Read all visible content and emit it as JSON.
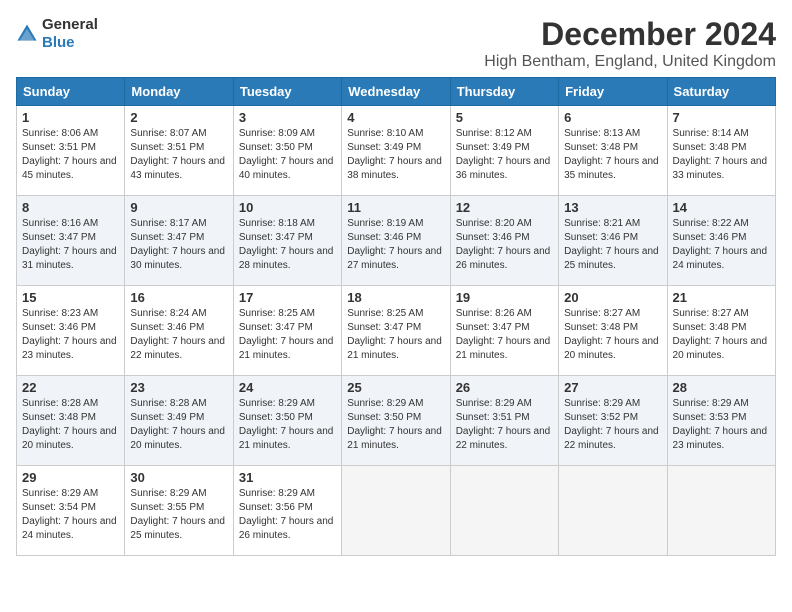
{
  "header": {
    "logo_general": "General",
    "logo_blue": "Blue",
    "title": "December 2024",
    "subtitle": "High Bentham, England, United Kingdom"
  },
  "calendar": {
    "days_of_week": [
      "Sunday",
      "Monday",
      "Tuesday",
      "Wednesday",
      "Thursday",
      "Friday",
      "Saturday"
    ],
    "weeks": [
      [
        null,
        null,
        null,
        null,
        null,
        null,
        null
      ]
    ]
  },
  "cells": {
    "w1": [
      {
        "day": "1",
        "sunrise": "8:06 AM",
        "sunset": "3:51 PM",
        "daylight": "7 hours and 45 minutes."
      },
      {
        "day": "2",
        "sunrise": "8:07 AM",
        "sunset": "3:51 PM",
        "daylight": "7 hours and 43 minutes."
      },
      {
        "day": "3",
        "sunrise": "8:09 AM",
        "sunset": "3:50 PM",
        "daylight": "7 hours and 40 minutes."
      },
      {
        "day": "4",
        "sunrise": "8:10 AM",
        "sunset": "3:49 PM",
        "daylight": "7 hours and 38 minutes."
      },
      {
        "day": "5",
        "sunrise": "8:12 AM",
        "sunset": "3:49 PM",
        "daylight": "7 hours and 36 minutes."
      },
      {
        "day": "6",
        "sunrise": "8:13 AM",
        "sunset": "3:48 PM",
        "daylight": "7 hours and 35 minutes."
      },
      {
        "day": "7",
        "sunrise": "8:14 AM",
        "sunset": "3:48 PM",
        "daylight": "7 hours and 33 minutes."
      }
    ],
    "w2": [
      {
        "day": "8",
        "sunrise": "8:16 AM",
        "sunset": "3:47 PM",
        "daylight": "7 hours and 31 minutes."
      },
      {
        "day": "9",
        "sunrise": "8:17 AM",
        "sunset": "3:47 PM",
        "daylight": "7 hours and 30 minutes."
      },
      {
        "day": "10",
        "sunrise": "8:18 AM",
        "sunset": "3:47 PM",
        "daylight": "7 hours and 28 minutes."
      },
      {
        "day": "11",
        "sunrise": "8:19 AM",
        "sunset": "3:46 PM",
        "daylight": "7 hours and 27 minutes."
      },
      {
        "day": "12",
        "sunrise": "8:20 AM",
        "sunset": "3:46 PM",
        "daylight": "7 hours and 26 minutes."
      },
      {
        "day": "13",
        "sunrise": "8:21 AM",
        "sunset": "3:46 PM",
        "daylight": "7 hours and 25 minutes."
      },
      {
        "day": "14",
        "sunrise": "8:22 AM",
        "sunset": "3:46 PM",
        "daylight": "7 hours and 24 minutes."
      }
    ],
    "w3": [
      {
        "day": "15",
        "sunrise": "8:23 AM",
        "sunset": "3:46 PM",
        "daylight": "7 hours and 23 minutes."
      },
      {
        "day": "16",
        "sunrise": "8:24 AM",
        "sunset": "3:46 PM",
        "daylight": "7 hours and 22 minutes."
      },
      {
        "day": "17",
        "sunrise": "8:25 AM",
        "sunset": "3:47 PM",
        "daylight": "7 hours and 21 minutes."
      },
      {
        "day": "18",
        "sunrise": "8:25 AM",
        "sunset": "3:47 PM",
        "daylight": "7 hours and 21 minutes."
      },
      {
        "day": "19",
        "sunrise": "8:26 AM",
        "sunset": "3:47 PM",
        "daylight": "7 hours and 21 minutes."
      },
      {
        "day": "20",
        "sunrise": "8:27 AM",
        "sunset": "3:48 PM",
        "daylight": "7 hours and 20 minutes."
      },
      {
        "day": "21",
        "sunrise": "8:27 AM",
        "sunset": "3:48 PM",
        "daylight": "7 hours and 20 minutes."
      }
    ],
    "w4": [
      {
        "day": "22",
        "sunrise": "8:28 AM",
        "sunset": "3:48 PM",
        "daylight": "7 hours and 20 minutes."
      },
      {
        "day": "23",
        "sunrise": "8:28 AM",
        "sunset": "3:49 PM",
        "daylight": "7 hours and 20 minutes."
      },
      {
        "day": "24",
        "sunrise": "8:29 AM",
        "sunset": "3:50 PM",
        "daylight": "7 hours and 21 minutes."
      },
      {
        "day": "25",
        "sunrise": "8:29 AM",
        "sunset": "3:50 PM",
        "daylight": "7 hours and 21 minutes."
      },
      {
        "day": "26",
        "sunrise": "8:29 AM",
        "sunset": "3:51 PM",
        "daylight": "7 hours and 22 minutes."
      },
      {
        "day": "27",
        "sunrise": "8:29 AM",
        "sunset": "3:52 PM",
        "daylight": "7 hours and 22 minutes."
      },
      {
        "day": "28",
        "sunrise": "8:29 AM",
        "sunset": "3:53 PM",
        "daylight": "7 hours and 23 minutes."
      }
    ],
    "w5": [
      {
        "day": "29",
        "sunrise": "8:29 AM",
        "sunset": "3:54 PM",
        "daylight": "7 hours and 24 minutes."
      },
      {
        "day": "30",
        "sunrise": "8:29 AM",
        "sunset": "3:55 PM",
        "daylight": "7 hours and 25 minutes."
      },
      {
        "day": "31",
        "sunrise": "8:29 AM",
        "sunset": "3:56 PM",
        "daylight": "7 hours and 26 minutes."
      },
      null,
      null,
      null,
      null
    ]
  },
  "labels": {
    "sunrise": "Sunrise:",
    "sunset": "Sunset:",
    "daylight": "Daylight:"
  }
}
